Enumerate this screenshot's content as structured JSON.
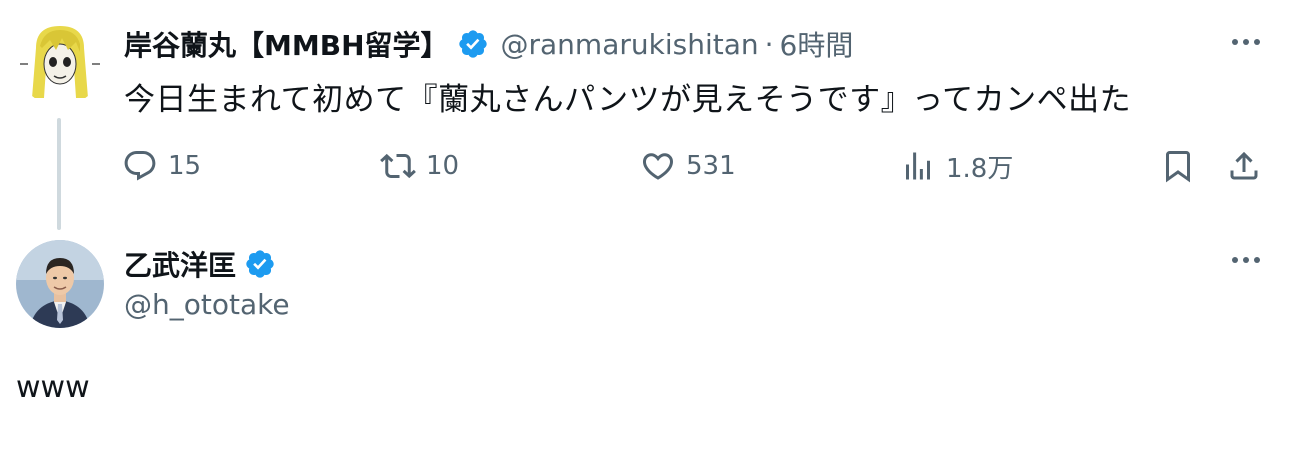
{
  "parent_tweet": {
    "display_name": "岸谷蘭丸【MMBH留学】",
    "handle": "@ranmarukishitan",
    "separator": "·",
    "time": "6時間",
    "text": "今日生まれて初めて『蘭丸さんパンツが見えそうです』ってカンペ出た",
    "actions": {
      "replies": "15",
      "retweets": "10",
      "likes": "531",
      "views": "1.8万"
    }
  },
  "reply_tweet": {
    "display_name": "乙武洋匡",
    "handle": "@h_ototake",
    "text": "www"
  },
  "colors": {
    "verified": "#1d9bf0",
    "secondary_text": "#536471",
    "thread_line": "#cfd9de"
  },
  "icons": [
    "verified-badge-icon",
    "more-icon",
    "reply-icon",
    "retweet-icon",
    "like-icon",
    "views-icon",
    "bookmark-icon",
    "share-icon"
  ]
}
